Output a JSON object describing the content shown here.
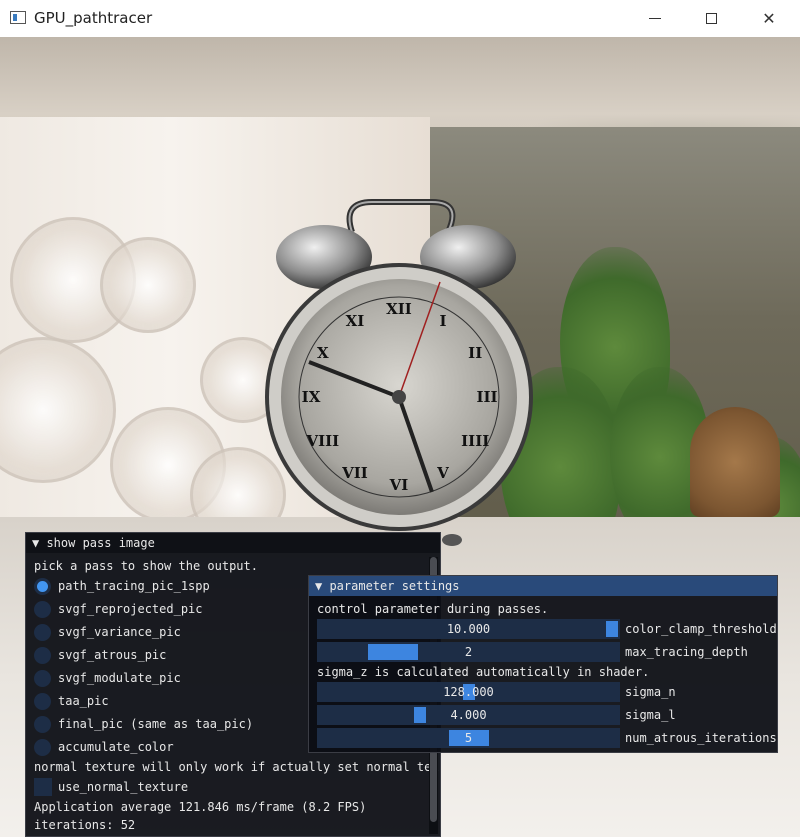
{
  "window": {
    "title": "GPU_pathtracer",
    "minimize_glyph": "",
    "maximize_glyph": "",
    "close_glyph": "✕"
  },
  "show_pass_panel": {
    "title": "▼ show pass image",
    "prompt": "pick a pass to show the output.",
    "options": [
      {
        "label": "path_tracing_pic_1spp",
        "selected": true
      },
      {
        "label": "svgf_reprojected_pic",
        "selected": false
      },
      {
        "label": "svgf_variance_pic",
        "selected": false
      },
      {
        "label": "svgf_atrous_pic",
        "selected": false
      },
      {
        "label": "svgf_modulate_pic",
        "selected": false
      },
      {
        "label": "taa_pic",
        "selected": false
      },
      {
        "label": "final_pic (same as taa_pic)",
        "selected": false
      },
      {
        "label": "accumulate_color",
        "selected": false
      }
    ],
    "normal_note": "normal texture will only work if actually set normal tex",
    "use_normal_texture_label": "use_normal_texture",
    "use_normal_texture_checked": false,
    "fps_text": "Application average 121.846 ms/frame (8.2 FPS)",
    "iterations_text": "iterations: 52"
  },
  "parameter_panel": {
    "title": "▼ parameter settings",
    "intro": "control parameter during passes.",
    "sigma_note": "sigma_z is calculated automatically in shader.",
    "sliders": [
      {
        "label": "color_clamp_threshold",
        "value": "10.000",
        "fraction": 0.99
      },
      {
        "label": "max_tracing_depth",
        "value": "2",
        "fraction": 0.25
      },
      {
        "label": "sigma_n",
        "value": "128.000",
        "fraction": 0.5
      },
      {
        "label": "sigma_l",
        "value": "4.000",
        "fraction": 0.34
      },
      {
        "label": "num_atrous_iterations",
        "value": "5",
        "fraction": 0.5
      }
    ]
  },
  "scene": {
    "clock_numerals": [
      "XII",
      "I",
      "II",
      "III",
      "IIII",
      "V",
      "VI",
      "VII",
      "VIII",
      "IX",
      "X",
      "XI"
    ]
  }
}
